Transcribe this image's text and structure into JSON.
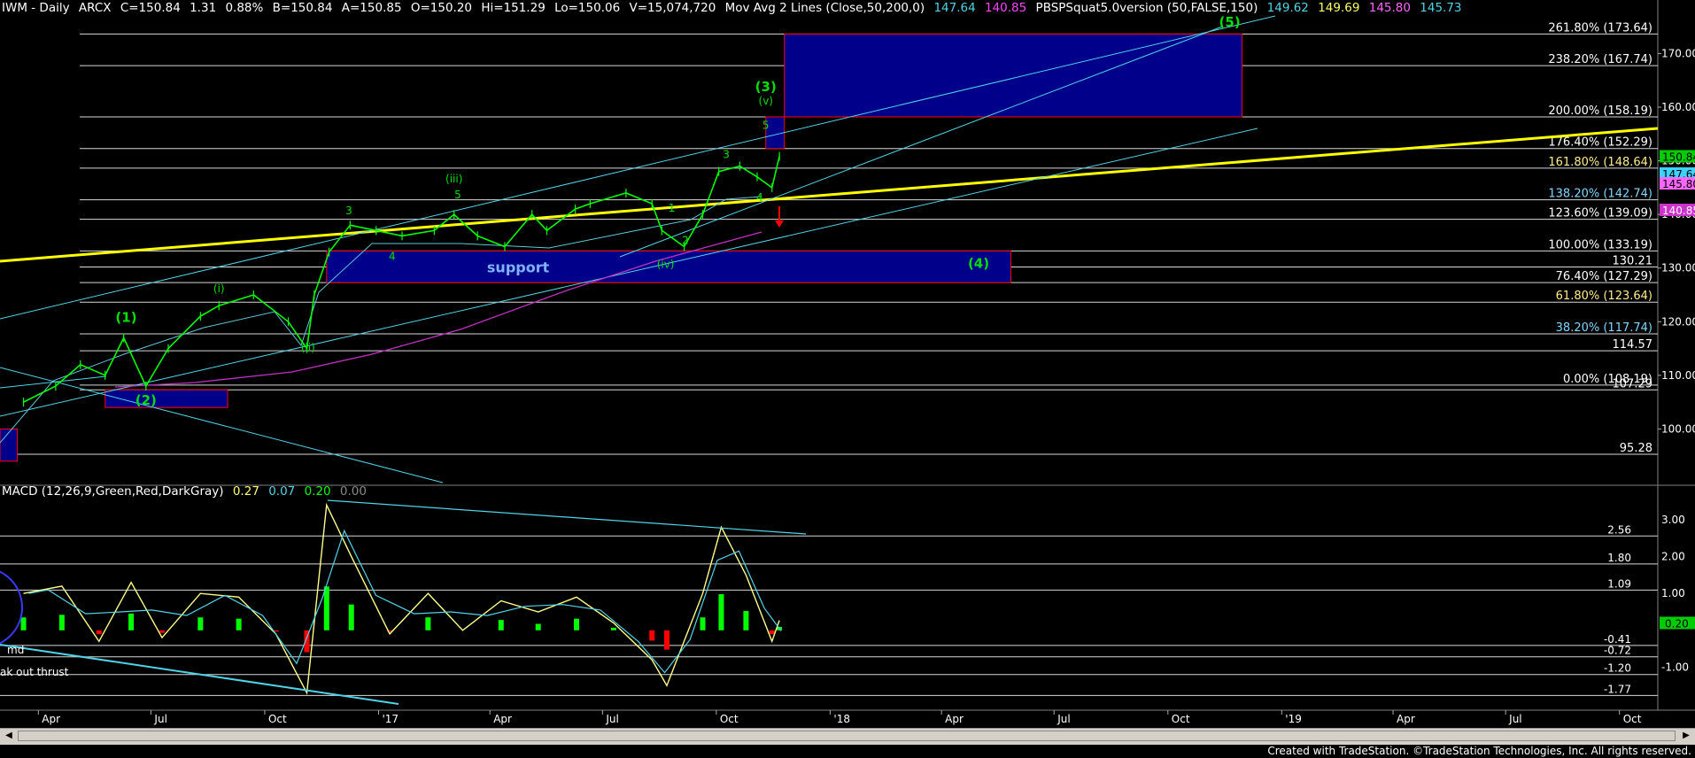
{
  "header": {
    "symbol": "IWM - Daily",
    "exchange": "ARCX",
    "last": "C=150.84",
    "change": "1.31",
    "change_pct": "0.88%",
    "bid": "B=150.84",
    "ask": "A=150.85",
    "open": "O=150.20",
    "high": "Hi=151.29",
    "low": "Lo=150.06",
    "volume": "V=15,074,720",
    "ma_label": "Mov Avg 2 Lines (Close,50,200,0)",
    "ma50": "147.64",
    "ma200": "140.85",
    "pbsp_label": "PBSPSquat5.0version (50,FALSE,150)",
    "pbsp1": "149.62",
    "pbsp2": "149.69",
    "pbsp3": "145.80",
    "pbsp4": "145.73"
  },
  "macd_header": {
    "label": "MACD (12,26,9,Green,Red,DarkGray)",
    "v1": "0.27",
    "v2": "0.07",
    "v3": "0.20",
    "v4": "0.00"
  },
  "footer": "Created with TradeStation. ©TradeStation Technologies, Inc. All rights reserved.",
  "colors": {
    "up": "#00ff00",
    "down": "#ff0000",
    "fib": "#ffffff",
    "trend": "#ffff00",
    "channel": "#4fd3e6",
    "box_fill": "#00008b",
    "box_border": "#ff0000",
    "wave": "#00e000",
    "ma200": "#c030c0"
  },
  "chart_data": [
    {
      "type": "line",
      "title": "IWM - Daily",
      "xlabel": "",
      "ylabel": "",
      "ylim": [
        90,
        178
      ],
      "x_ticks": [
        "Apr",
        "Jul",
        "Oct",
        "'17",
        "Apr",
        "Jul",
        "Oct",
        "'18",
        "Apr",
        "Jul",
        "Oct",
        "'19",
        "Apr",
        "Jul",
        "Oct"
      ],
      "y_ticks": [
        "100.00",
        "110.00",
        "120.00",
        "130.00",
        "140.00",
        "150.00",
        "160.00",
        "170.00"
      ],
      "series": [
        {
          "name": "IWM",
          "x": [
            "2016-03-20",
            "2016-04-15",
            "2016-05-05",
            "2016-05-25",
            "2016-06-09",
            "2016-06-27",
            "2016-07-15",
            "2016-08-10",
            "2016-08-25",
            "2016-09-22",
            "2016-10-20",
            "2016-11-04",
            "2016-11-10",
            "2016-11-22",
            "2016-12-09",
            "2016-12-30",
            "2017-01-20",
            "2017-02-15",
            "2017-03-03",
            "2017-03-22",
            "2017-04-13",
            "2017-05-05",
            "2017-05-17",
            "2017-06-09",
            "2017-06-21",
            "2017-07-20",
            "2017-08-10",
            "2017-08-18",
            "2017-09-05",
            "2017-09-20",
            "2017-10-03",
            "2017-10-20",
            "2017-11-03",
            "2017-11-15",
            "2017-11-21"
          ],
          "values": [
            105,
            108,
            112,
            110,
            117,
            108,
            115,
            121,
            123,
            125,
            120,
            115,
            125,
            133,
            138,
            137,
            136,
            137,
            140,
            136,
            134,
            140,
            137,
            141,
            142,
            144,
            142,
            137,
            134,
            140,
            148,
            149,
            147,
            145,
            150.84
          ]
        }
      ],
      "horizontal_levels": [
        {
          "label": "261.80% (173.64)",
          "value": 173.64
        },
        {
          "label": "238.20% (167.74)",
          "value": 167.74
        },
        {
          "label": "200.00% (158.19)",
          "value": 158.19
        },
        {
          "label": "176.40% (152.29)",
          "value": 152.29
        },
        {
          "label": "161.80% (148.64)",
          "value": 148.64
        },
        {
          "label": "138.20% (142.74)",
          "value": 142.74
        },
        {
          "label": "123.60% (139.09)",
          "value": 139.09
        },
        {
          "label": "100.00% (133.19)",
          "value": 133.19
        },
        {
          "label": "130.21",
          "value": 130.21
        },
        {
          "label": "76.40% (127.29)",
          "value": 127.29
        },
        {
          "label": "61.80% (123.64)",
          "value": 123.64
        },
        {
          "label": "38.20% (117.74)",
          "value": 117.74
        },
        {
          "label": "114.57",
          "value": 114.57
        },
        {
          "label": "0.00% (108.19)",
          "value": 108.19
        },
        {
          "label": "107.29",
          "value": 107.29
        },
        {
          "label": "95.28",
          "value": 95.28
        }
      ],
      "price_badges": [
        "150.84",
        "147.64",
        "145.80",
        "140.85"
      ],
      "zones": [
        {
          "label": "support",
          "low": 127.29,
          "high": 133.19
        },
        {
          "label": "",
          "low": 158.19,
          "high": 173.64
        },
        {
          "label": "",
          "low": 152.29,
          "high": 158.19
        },
        {
          "label": "",
          "low": 104,
          "high": 107.29
        },
        {
          "label": "",
          "low": 94,
          "high": 100
        }
      ],
      "wave_labels": [
        {
          "label": "(1)",
          "x": "2016-06-11",
          "y": 120
        },
        {
          "label": "(2)",
          "x": "2016-06-27",
          "y": 104.5
        },
        {
          "label": "(i)",
          "x": "2016-08-25",
          "y": 125.5
        },
        {
          "label": "(ii)",
          "x": "2016-11-05",
          "y": 114.5
        },
        {
          "label": "3",
          "x": "2016-12-08",
          "y": 140
        },
        {
          "label": "4",
          "x": "2017-01-12",
          "y": 131.5
        },
        {
          "label": "(iii)",
          "x": "2017-03-03",
          "y": 146
        },
        {
          "label": "5",
          "x": "2017-03-06",
          "y": 143
        },
        {
          "label": "1",
          "x": "2017-08-26",
          "y": 140.5
        },
        {
          "label": "(iv)",
          "x": "2017-08-21",
          "y": 130
        },
        {
          "label": "2",
          "x": "2017-09-06",
          "y": 134.5
        },
        {
          "label": "3",
          "x": "2017-10-09",
          "y": 150.5
        },
        {
          "label": "4",
          "x": "2017-11-05",
          "y": 142.5
        },
        {
          "label": "5",
          "x": "2017-11-10",
          "y": 156
        },
        {
          "label": "(v)",
          "x": "2017-11-10",
          "y": 160.5
        },
        {
          "label": "(3)",
          "x": "2017-11-10",
          "y": 163
        },
        {
          "label": "(4)",
          "x": "2018-05-01",
          "y": 130
        },
        {
          "label": "(5)",
          "x": "2018-11-20",
          "y": 175
        }
      ]
    },
    {
      "type": "bar",
      "title": "MACD (12,26,9,Green,Red,DarkGray)",
      "ylim": [
        -2.0,
        3.6
      ],
      "y_ticks": [
        "3.00",
        "2.00",
        "1.00",
        "-1.00"
      ],
      "horizontal_levels": [
        {
          "label": "2.56",
          "value": 2.56
        },
        {
          "label": "1.80",
          "value": 1.8
        },
        {
          "label": "1.09",
          "value": 1.09
        },
        {
          "label": "-0.41",
          "value": -0.41
        },
        {
          "label": "-0.72",
          "value": -0.72
        },
        {
          "label": "-1.20",
          "value": -1.2
        },
        {
          "label": "-1.77",
          "value": -1.77
        }
      ],
      "current_value_badge": "0.20",
      "annotations": [
        "md",
        "ak out thrust"
      ],
      "series": [
        {
          "name": "MACD",
          "x": [
            "2016-03-20",
            "2016-04-20",
            "2016-05-20",
            "2016-06-15",
            "2016-07-10",
            "2016-08-10",
            "2016-09-10",
            "2016-10-10",
            "2016-11-04",
            "2016-11-20",
            "2016-12-10",
            "2017-01-10",
            "2017-02-10",
            "2017-03-10",
            "2017-04-10",
            "2017-05-10",
            "2017-06-10",
            "2017-07-10",
            "2017-08-10",
            "2017-08-22",
            "2017-09-20",
            "2017-10-05",
            "2017-10-25",
            "2017-11-15",
            "2017-11-21"
          ],
          "values": [
            1.0,
            1.2,
            -0.3,
            1.3,
            -0.2,
            1.0,
            0.9,
            -0.1,
            -1.7,
            3.4,
            2.0,
            -0.1,
            1.0,
            0.0,
            0.8,
            0.5,
            0.9,
            0.2,
            -0.8,
            -1.5,
            1.0,
            2.8,
            1.5,
            -0.3,
            0.27
          ]
        }
      ]
    }
  ]
}
